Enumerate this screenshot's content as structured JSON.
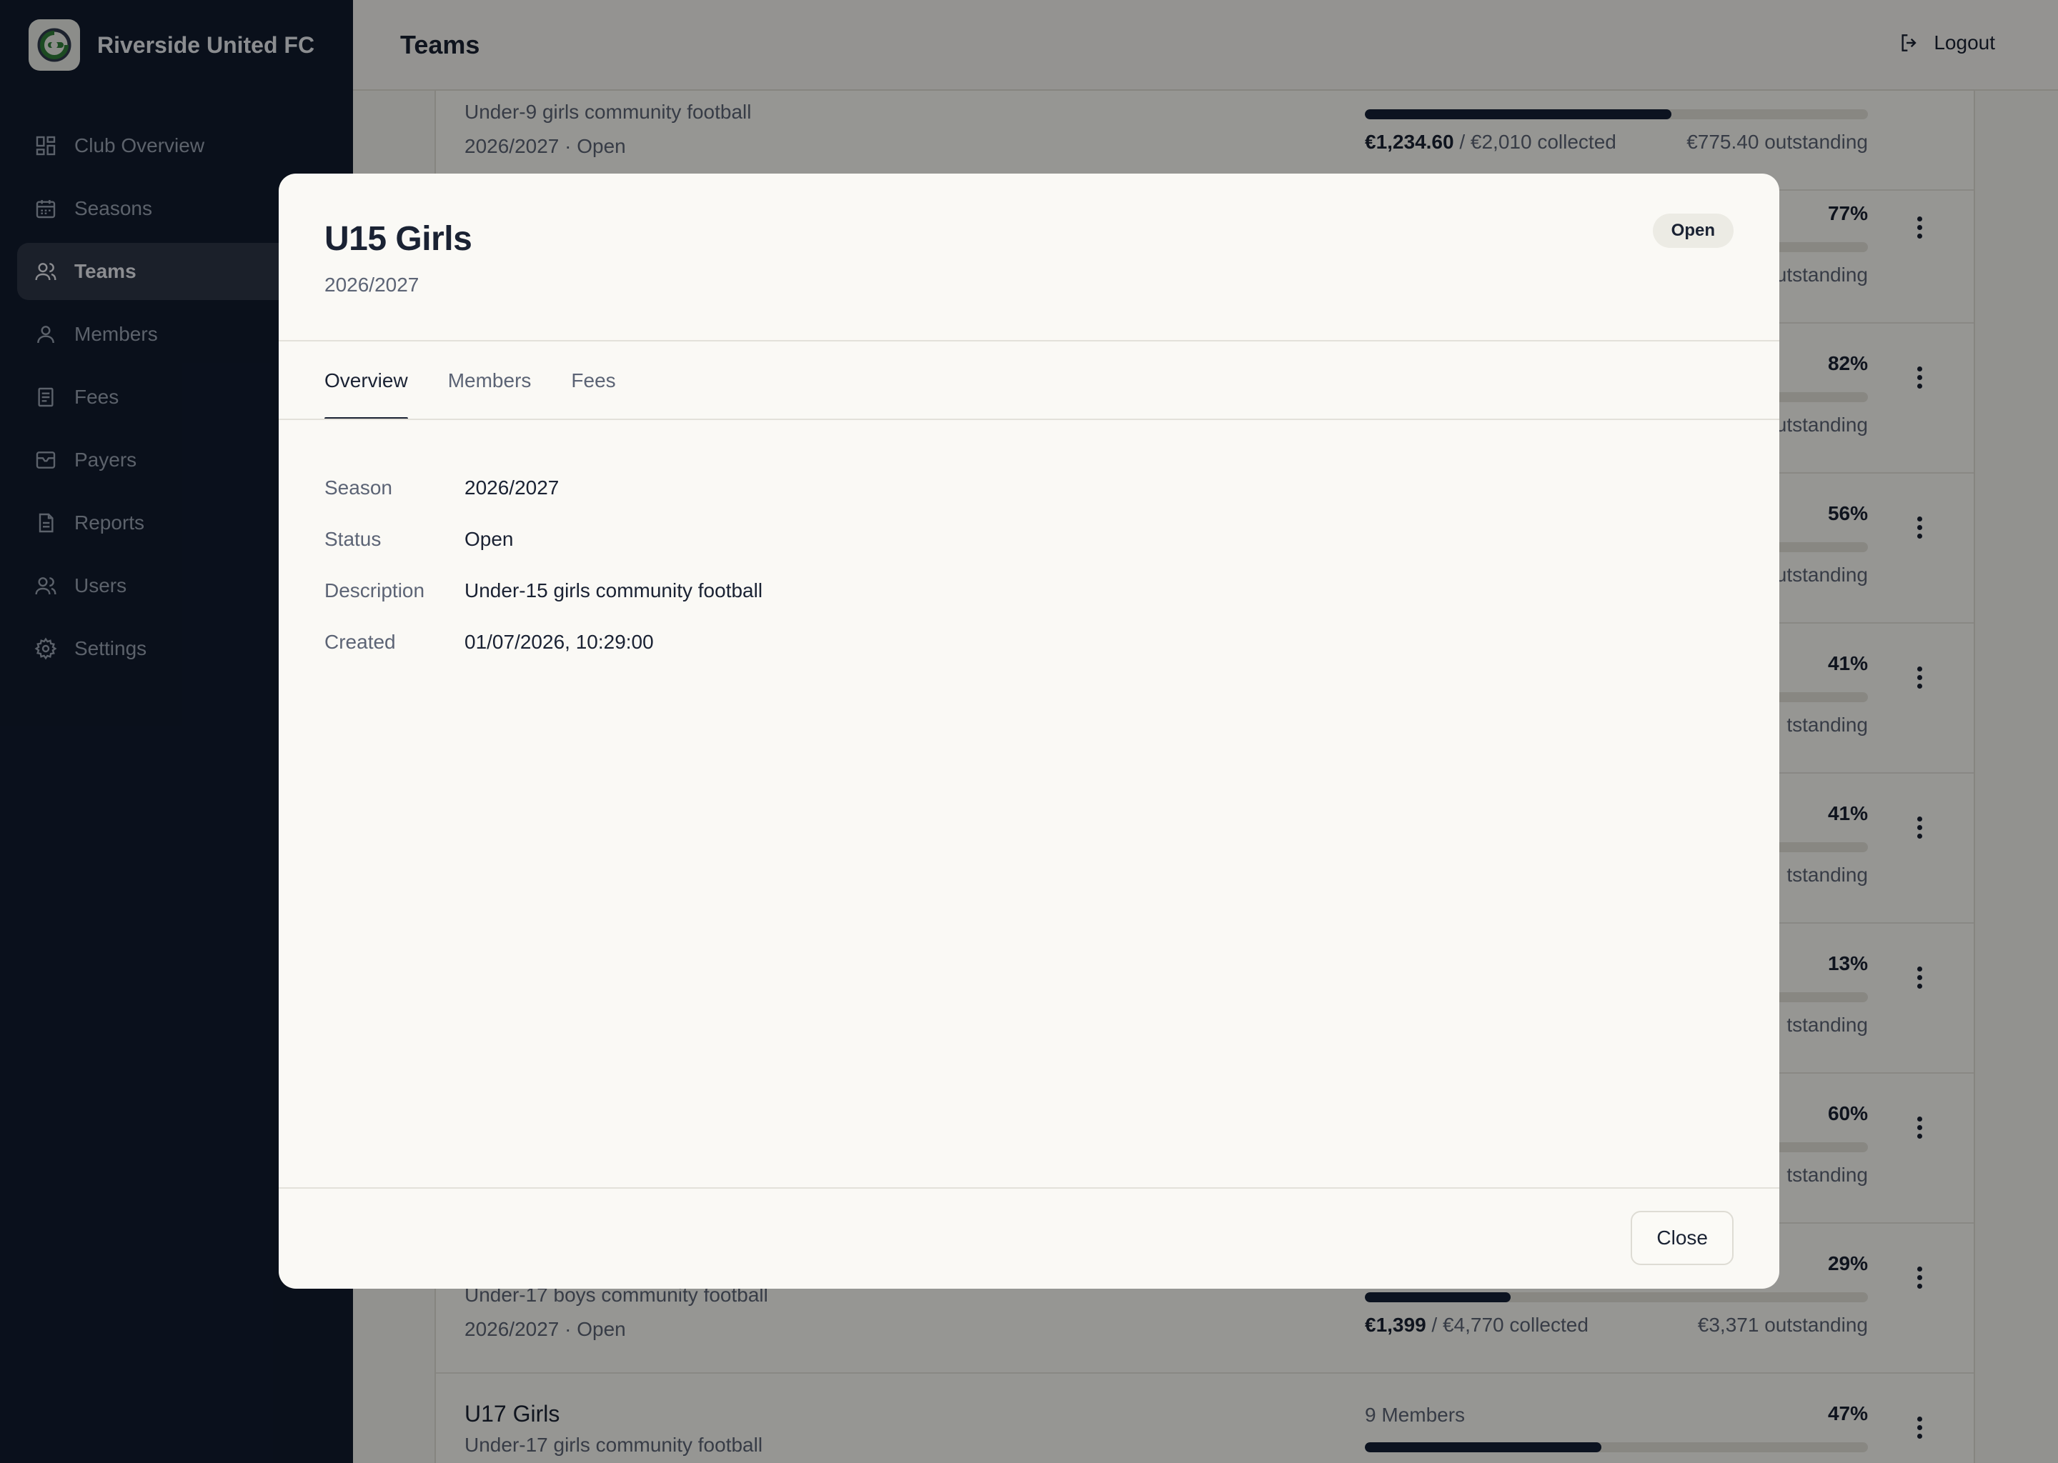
{
  "brand": {
    "name": "Riverside United FC"
  },
  "sidebar": {
    "items": [
      {
        "label": "Club Overview",
        "icon": "grid-icon"
      },
      {
        "label": "Seasons",
        "icon": "calendar-icon"
      },
      {
        "label": "Teams",
        "icon": "users-icon",
        "active": true
      },
      {
        "label": "Members",
        "icon": "user-icon"
      },
      {
        "label": "Fees",
        "icon": "receipt-icon"
      },
      {
        "label": "Payers",
        "icon": "wallet-icon"
      },
      {
        "label": "Reports",
        "icon": "report-icon"
      },
      {
        "label": "Users",
        "icon": "users-icon"
      },
      {
        "label": "Settings",
        "icon": "gear-icon"
      }
    ]
  },
  "header": {
    "title": "Teams",
    "logout_label": "Logout"
  },
  "teams": [
    {
      "desc": "Under-9 girls community football",
      "season": "2026/2027 · Open",
      "collected_amount": "€1,234.60",
      "collected_total": " / €2,010 collected",
      "outstanding": "€775.40 outstanding",
      "progress": 61
    },
    {
      "pct": "77%",
      "outstanding": "utstanding"
    },
    {
      "pct": "82%",
      "outstanding": "utstanding"
    },
    {
      "pct": "56%",
      "outstanding": "utstanding"
    },
    {
      "pct": "41%",
      "outstanding": "tstanding"
    },
    {
      "pct": "41%",
      "outstanding": "tstanding"
    },
    {
      "pct": "13%",
      "outstanding": "tstanding"
    },
    {
      "pct": "60%",
      "outstanding": "tstanding"
    },
    {
      "desc": "Under-17 boys community football",
      "season": "2026/2027 · Open",
      "pct": "29%",
      "collected_amount": "€1,399",
      "collected_total": " / €4,770 collected",
      "outstanding": "€3,371 outstanding",
      "progress": 29
    },
    {
      "name": "U17 Girls",
      "desc": "Under-17 girls community football",
      "members": "9 Members",
      "pct": "47%",
      "progress": 47
    }
  ],
  "modal": {
    "title": "U15 Girls",
    "subtitle": "2026/2027",
    "badge": "Open",
    "tabs": [
      {
        "label": "Overview",
        "active": true
      },
      {
        "label": "Members"
      },
      {
        "label": "Fees"
      }
    ],
    "details": [
      {
        "key": "Season",
        "value": "2026/2027"
      },
      {
        "key": "Status",
        "value": "Open"
      },
      {
        "key": "Description",
        "value": "Under-15 girls community football"
      },
      {
        "key": "Created",
        "value": "01/07/2026, 10:29:00"
      }
    ],
    "close_label": "Close"
  },
  "colors": {
    "sidebar_bg": "#111b2e",
    "accent": "#142036",
    "logo_green": "#2f7d3a"
  }
}
